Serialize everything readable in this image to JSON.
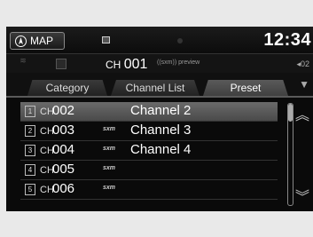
{
  "header": {
    "map_label": "MAP",
    "clock": "12:34",
    "channel_prefix": "CH",
    "channel_number": "001",
    "preview_label": "((sxm)) preview",
    "volume": "02"
  },
  "tabs": [
    {
      "label": "Category"
    },
    {
      "label": "Channel List"
    },
    {
      "label": "Preset"
    }
  ],
  "list": [
    {
      "index": "1",
      "prefix": "CH",
      "number": "002",
      "name": "Channel 2",
      "logo": ""
    },
    {
      "index": "2",
      "prefix": "CH",
      "number": "003",
      "name": "Channel 3",
      "logo": "sxm"
    },
    {
      "index": "3",
      "prefix": "CH",
      "number": "004",
      "name": "Channel 4",
      "logo": "sxm"
    },
    {
      "index": "4",
      "prefix": "CH",
      "number": "005",
      "name": "",
      "logo": "sxm"
    },
    {
      "index": "5",
      "prefix": "CH",
      "number": "006",
      "name": "",
      "logo": "sxm"
    }
  ],
  "selected_index": 0,
  "icons": {
    "nav": "compass-icon",
    "up": "double-chevron-up-icon",
    "down": "double-chevron-down-icon"
  }
}
